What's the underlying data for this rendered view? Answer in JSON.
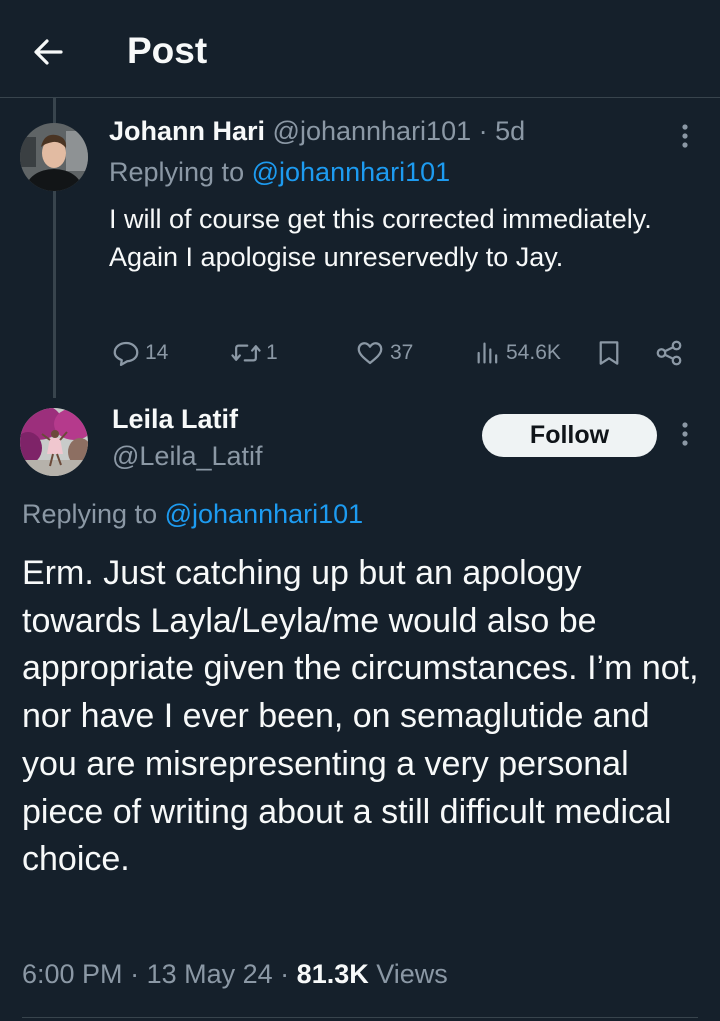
{
  "header": {
    "title": "Post"
  },
  "reply_tweet": {
    "author_name": "Johann Hari",
    "author_handle": "@johannhari101",
    "age": "· 5d",
    "replying_to_prefix": "Replying to",
    "replying_to_handle": "@johannhari101",
    "body": "I will of course get this corrected immediately. Again I apologise unreservedly to Jay.",
    "stats": {
      "replies": "14",
      "reposts": "1",
      "likes": "37",
      "views": "54.6K"
    }
  },
  "main_tweet": {
    "author_name": "Leila Latif",
    "author_handle": "@Leila_Latif",
    "follow_label": "Follow",
    "replying_to_prefix": "Replying to",
    "replying_to_handle": "@johannhari101",
    "body": "Erm. Just catching up but an apology towards Layla/Leyla/me would also be appropriate given the circumstances. I’m not, nor have I ever been, on semaglutide and you are misrepresenting a very personal piece of writing about a still difficult medical choice.",
    "time": "6:00 PM",
    "date": "13 May 24",
    "views_count": "81.3K",
    "views_label": "Views"
  },
  "colors": {
    "background": "#15202b",
    "text_primary": "#f7f9f9",
    "text_secondary": "#8b98a5",
    "link": "#1d9bf0",
    "divider": "#38444d"
  },
  "icons": [
    "back-arrow-icon",
    "more-icon",
    "reply-icon",
    "repost-icon",
    "like-icon",
    "views-icon",
    "bookmark-icon",
    "share-icon"
  ]
}
